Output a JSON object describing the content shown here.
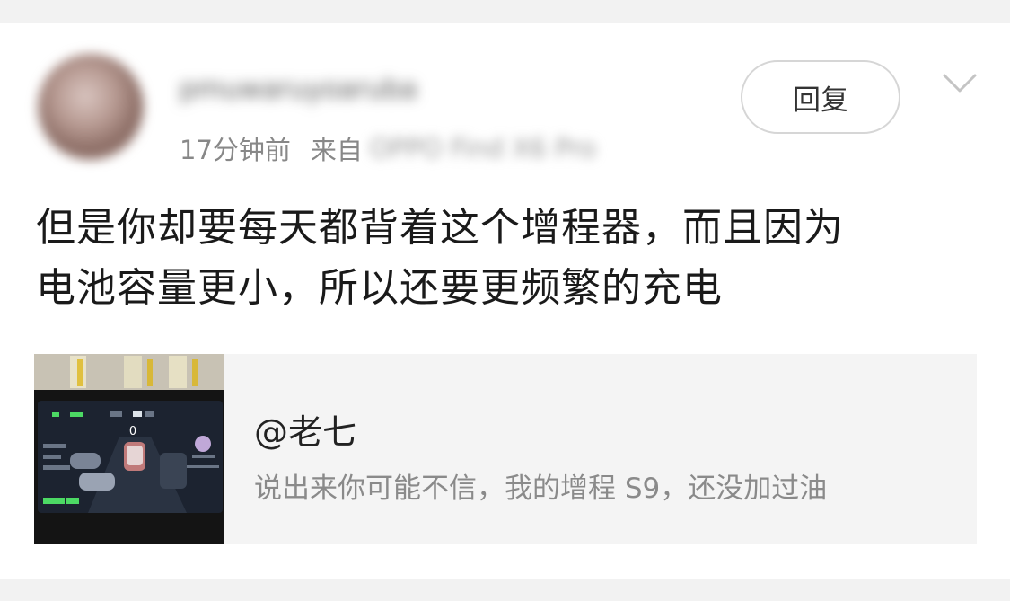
{
  "comment": {
    "username": "pmuwaruyoaruba",
    "time": "17分钟前",
    "from_label": "来自",
    "from_device": "OPPO Find X6 Pro",
    "reply_label": "回复",
    "more_icon": "chevron-down-icon",
    "body_line1": "但是你却要每天都背着这个增程器，而且因为",
    "body_line2": "电池容量更小，所以还要更频繁的充电"
  },
  "quote": {
    "author": "@老七",
    "text": "说出来你可能不信，我的增程 S9，还没加过油",
    "thumbnail": {
      "speed": "0",
      "time": "18:37",
      "temperature": "31°C",
      "range": "253",
      "colors": {
        "accent": "#4cd964",
        "screen_bg": "#1c2330"
      }
    }
  },
  "colors": {
    "page_bg": "#f2f2f2",
    "card_bg": "#ffffff",
    "quote_bg": "#f4f4f4",
    "meta_text": "#888888",
    "body_text": "#1a1a1a"
  }
}
